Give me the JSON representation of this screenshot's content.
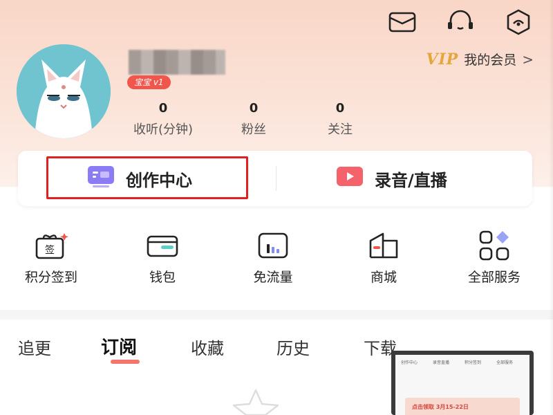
{
  "header": {
    "icons": [
      "mail-icon",
      "customer-service-icon",
      "scan-icon"
    ],
    "level_badge": "宝宝 v1",
    "vip": {
      "logo": "VIP",
      "label": "我的会员",
      "arrow": ">"
    }
  },
  "stats": [
    {
      "value": "0",
      "label": "收听(分钟)"
    },
    {
      "value": "0",
      "label": "粉丝"
    },
    {
      "value": "0",
      "label": "关注"
    }
  ],
  "create": {
    "creation_center": "创作中心",
    "record_live": "录音/直播"
  },
  "services": [
    {
      "label": "积分签到",
      "icon": "sign-in-gift-icon"
    },
    {
      "label": "钱包",
      "icon": "wallet-icon"
    },
    {
      "label": "免流量",
      "icon": "free-data-icon"
    },
    {
      "label": "商城",
      "icon": "mall-icon"
    },
    {
      "label": "全部服务",
      "icon": "all-services-icon"
    }
  ],
  "tabs": [
    {
      "label": "追更"
    },
    {
      "label": "订阅",
      "active": true
    },
    {
      "label": "收藏"
    },
    {
      "label": "历史"
    },
    {
      "label": "下载"
    }
  ],
  "thumbnail": {
    "row": [
      "创作中心",
      "录音直播",
      "积分签到",
      "全部服务"
    ],
    "banner": "点击领取 3月15-22日"
  },
  "colors": {
    "accent": "#f0564b",
    "vip_gold": "#e4a73b",
    "highlight": "#e02020",
    "header_bg": "#f9d6c7"
  }
}
